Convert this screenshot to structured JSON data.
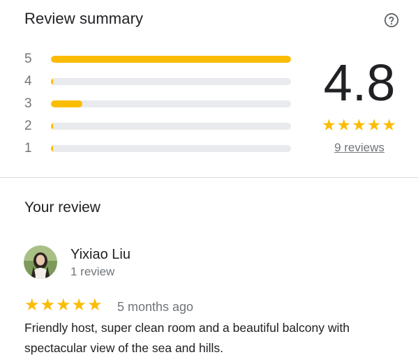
{
  "summary": {
    "title": "Review summary",
    "help_icon": "help-circle-icon",
    "bars": [
      {
        "rating": "5",
        "fraction": 1.0
      },
      {
        "rating": "4",
        "fraction": 0.008
      },
      {
        "rating": "3",
        "fraction": 0.13
      },
      {
        "rating": "2",
        "fraction": 0.008
      },
      {
        "rating": "1",
        "fraction": 0.008
      }
    ],
    "average": "4.8",
    "stars": "★★★★★",
    "reviews_link": "9 reviews"
  },
  "your_review": {
    "heading": "Your review",
    "reviewer_name": "Yixiao Liu",
    "reviewer_count": "1 review",
    "stars": "★★★★★",
    "time": "5 months ago",
    "text": "Friendly host, super clean room and a beautiful balcony with spectacular view of the sea and hills."
  },
  "colors": {
    "accent": "#fbbc04",
    "track": "#e8eaed",
    "muted_text": "#70757a",
    "divider": "#dadce0"
  }
}
